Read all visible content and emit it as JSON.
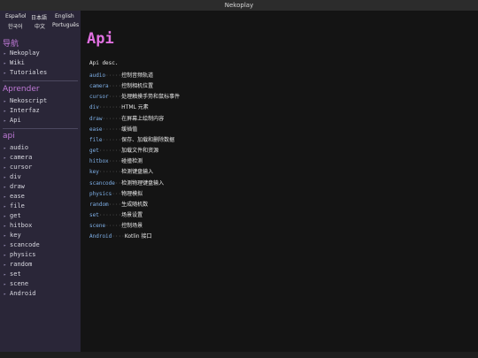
{
  "window": {
    "title": "Nekoplay"
  },
  "languages": [
    "Español",
    "日本語",
    "English",
    "한국어",
    "中文",
    "Português"
  ],
  "sidebar": {
    "sections": [
      {
        "title": "导航",
        "items": [
          "Nekoplay",
          "Wiki",
          "Tutoriales"
        ]
      },
      {
        "title": "Aprender",
        "items": [
          "Nekoscript",
          "Interfaz",
          "Api"
        ]
      },
      {
        "title": "api",
        "items": [
          "audio",
          "camera",
          "cursor",
          "div",
          "draw",
          "ease",
          "file",
          "get",
          "hitbox",
          "key",
          "scancode",
          "physics",
          "random",
          "set",
          "scene",
          "Android"
        ]
      }
    ],
    "arrow_glyph": "▸"
  },
  "content": {
    "title": "Api",
    "description": "Api desc.",
    "rows": [
      {
        "key": "audio",
        "dots": "·····",
        "value": "控制音频轨道"
      },
      {
        "key": "camera",
        "dots": "····",
        "value": "控制相机位置"
      },
      {
        "key": "cursor",
        "dots": "····",
        "value": "处理触摸手势和鼠标事件"
      },
      {
        "key": "div",
        "dots": "·······",
        "value": "HTML 元素"
      },
      {
        "key": "draw",
        "dots": "······",
        "value": "在屏幕上绘制内容"
      },
      {
        "key": "ease",
        "dots": "······",
        "value": "缓插值"
      },
      {
        "key": "file",
        "dots": "······",
        "value": "保存、加载和删除数据"
      },
      {
        "key": "get",
        "dots": "·······",
        "value": "加载文件和资源"
      },
      {
        "key": "hitbox",
        "dots": "····",
        "value": "碰撞检测"
      },
      {
        "key": "key",
        "dots": "·······",
        "value": "检测键盘输入"
      },
      {
        "key": "scancode",
        "dots": "··",
        "value": "检测物理键盘输入"
      },
      {
        "key": "physics",
        "dots": "···",
        "value": "物理模拟"
      },
      {
        "key": "random",
        "dots": "····",
        "value": "生成随机数"
      },
      {
        "key": "set",
        "dots": "·······",
        "value": "场景设置"
      },
      {
        "key": "scene",
        "dots": "·····",
        "value": "控制场景"
      },
      {
        "key": "Android",
        "dots": "····",
        "value": "Kotlin 接口"
      }
    ]
  },
  "colors": {
    "sidebar_bg": "#2a2638",
    "section_title": "#c07ad8",
    "page_title": "#e070e0",
    "api_key": "#7fb0e8"
  }
}
